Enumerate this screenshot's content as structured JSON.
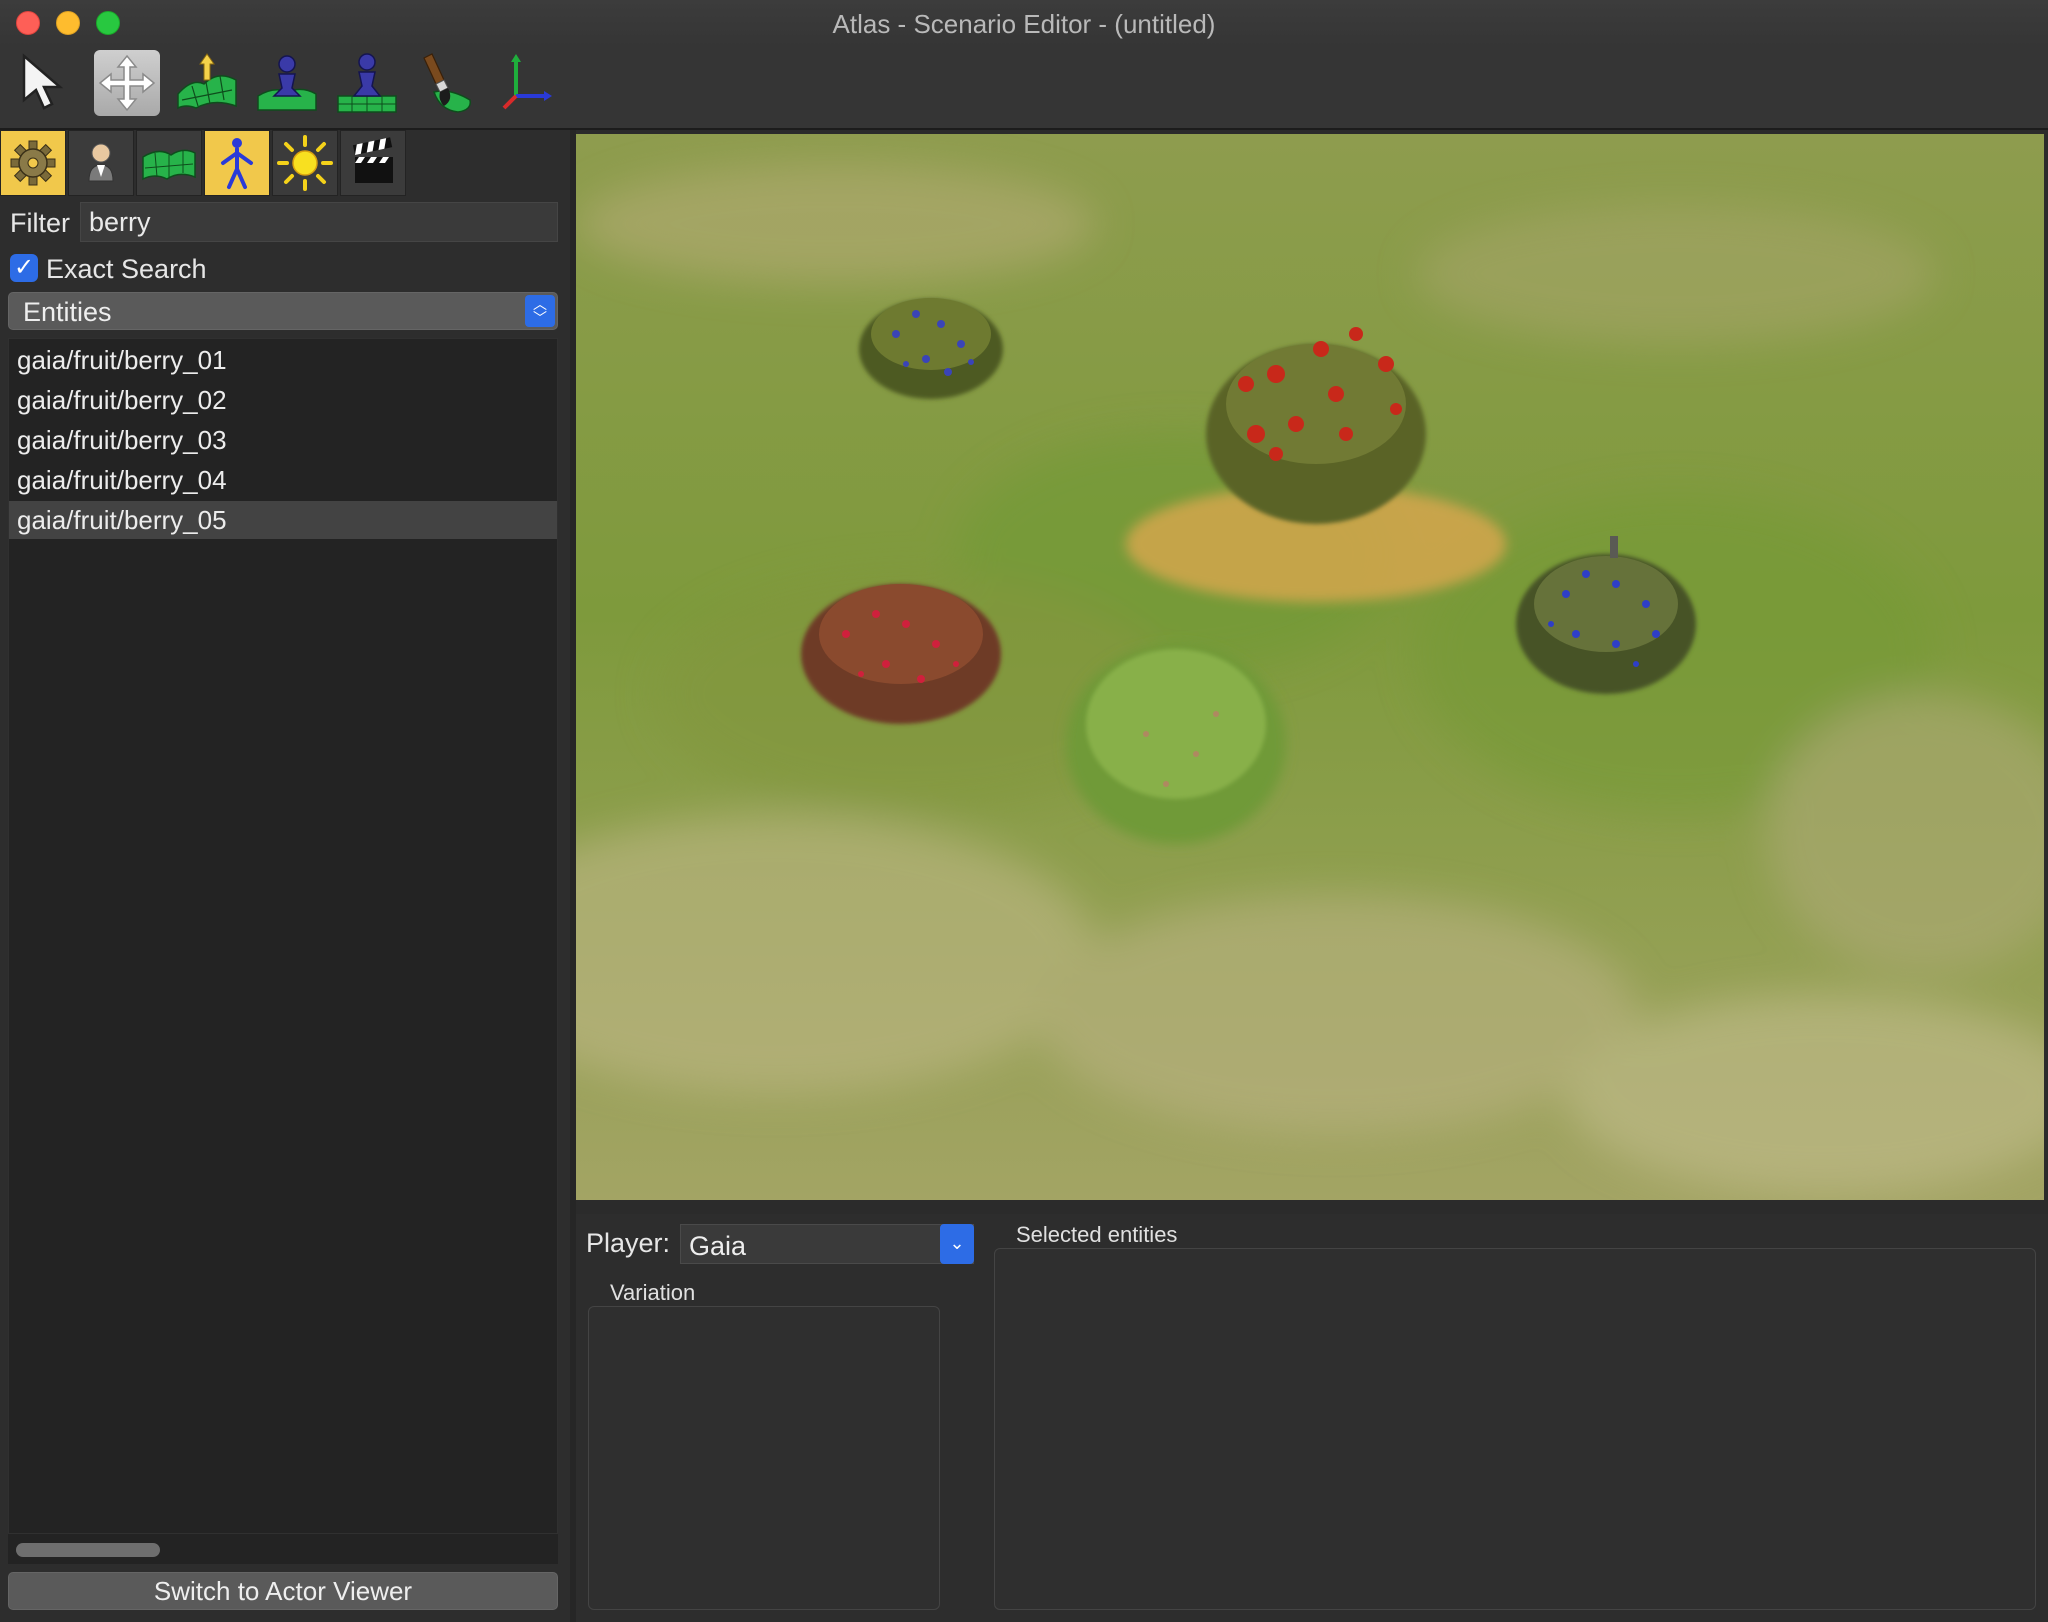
{
  "window": {
    "title": "Atlas - Scenario Editor - (untitled)"
  },
  "toolbar": {
    "tools": [
      {
        "name": "select-tool",
        "icon": "cursor-icon",
        "active": false
      },
      {
        "name": "transform-tool",
        "icon": "move-arrows-icon",
        "active": true
      },
      {
        "name": "alter-elevation-tool",
        "icon": "terrain-raise-icon",
        "active": false
      },
      {
        "name": "place-object-tool",
        "icon": "pawn-terrain-icon",
        "active": false
      },
      {
        "name": "place-object-alt-tool",
        "icon": "pawn-grid-icon",
        "active": false
      },
      {
        "name": "paint-terrain-tool",
        "icon": "paintbrush-icon",
        "active": false
      },
      {
        "name": "axes-tool",
        "icon": "axes-icon",
        "active": false
      }
    ]
  },
  "sidebar": {
    "tabs": [
      {
        "name": "map-settings",
        "icon": "gear-icon",
        "selected": true
      },
      {
        "name": "player",
        "icon": "person-icon",
        "selected": false
      },
      {
        "name": "terrain",
        "icon": "terrain-icon",
        "selected": false
      },
      {
        "name": "object",
        "icon": "figure-icon",
        "selected": true
      },
      {
        "name": "environment",
        "icon": "sun-icon",
        "selected": false
      },
      {
        "name": "cinema",
        "icon": "clapperboard-icon",
        "selected": false
      }
    ],
    "filter_label": "Filter",
    "filter_value": "berry",
    "exact_search_label": "Exact Search",
    "exact_search_checked": true,
    "object_type": "Entities",
    "items": [
      {
        "label": "gaia/fruit/berry_01",
        "selected": false
      },
      {
        "label": "gaia/fruit/berry_02",
        "selected": false
      },
      {
        "label": "gaia/fruit/berry_03",
        "selected": false
      },
      {
        "label": "gaia/fruit/berry_04",
        "selected": false
      },
      {
        "label": "gaia/fruit/berry_05",
        "selected": true
      }
    ],
    "switch_button": "Switch to Actor Viewer"
  },
  "bottom": {
    "player_label": "Player:",
    "player_value": "Gaia",
    "variation_title": "Variation",
    "selected_title": "Selected entities"
  },
  "colors": {
    "accent": "#2d6ce6",
    "tab_selected": "#f1c84b",
    "grass": "#8b9a4a"
  }
}
